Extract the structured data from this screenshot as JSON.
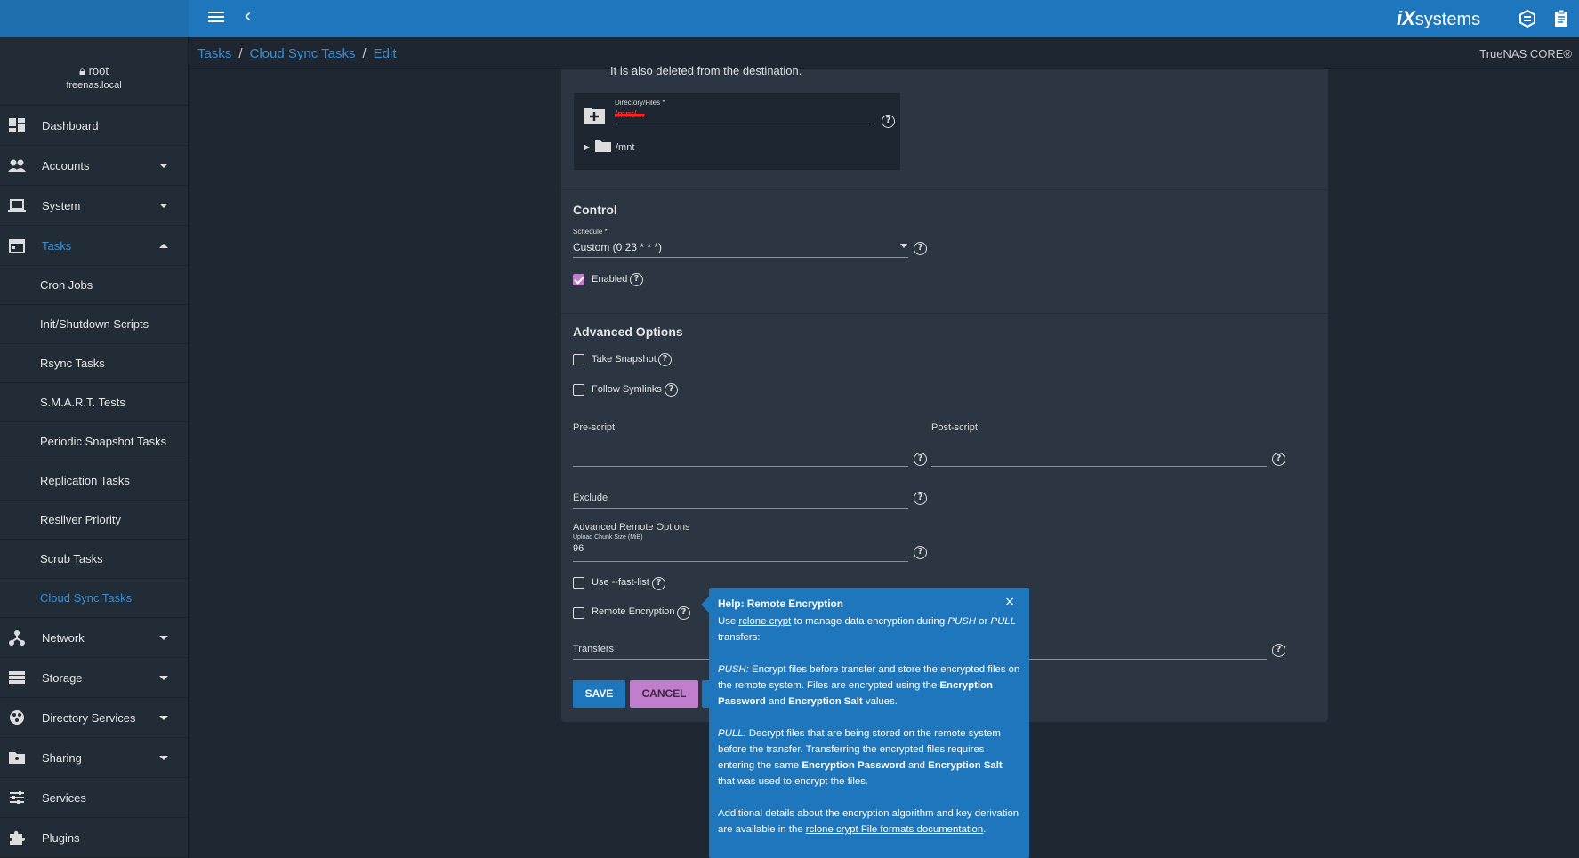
{
  "topbar": {
    "brand_ix": "iX",
    "brand_systems": "systems"
  },
  "breadcrumb": {
    "items": [
      "Tasks",
      "Cloud Sync Tasks",
      "Edit"
    ]
  },
  "product_name": "TrueNAS CORE®",
  "user": {
    "name": "root",
    "host": "freenas.local"
  },
  "sidebar": {
    "items": [
      {
        "label": "Dashboard",
        "icon": "dashboard-icon"
      },
      {
        "label": "Accounts",
        "icon": "people-icon"
      },
      {
        "label": "System",
        "icon": "laptop-icon"
      },
      {
        "label": "Tasks",
        "icon": "calendar-icon"
      },
      {
        "label": "Network",
        "icon": "network-icon"
      },
      {
        "label": "Storage",
        "icon": "storage-icon"
      },
      {
        "label": "Directory Services",
        "icon": "directory-icon"
      },
      {
        "label": "Sharing",
        "icon": "folder-share-icon"
      },
      {
        "label": "Services",
        "icon": "sliders-icon"
      },
      {
        "label": "Plugins",
        "icon": "puzzle-icon"
      }
    ],
    "task_subitems": [
      "Cron Jobs",
      "Init/Shutdown Scripts",
      "Rsync Tasks",
      "S.M.A.R.T. Tests",
      "Periodic Snapshot Tasks",
      "Replication Tasks",
      "Resilver Priority",
      "Scrub Tasks",
      "Cloud Sync Tasks"
    ]
  },
  "form": {
    "top_text_pre": "It is also ",
    "top_text_link": "deleted",
    "top_text_post": " from the destination.",
    "directory_label": "Directory/Files *",
    "directory_value": "/mnt/...",
    "tree_root": "/mnt",
    "control_title": "Control",
    "schedule_label": "Schedule *",
    "schedule_value": "Custom (0 23 * * *)",
    "enabled_label": "Enabled",
    "enabled_checked": true,
    "advanced_title": "Advanced Options",
    "take_snapshot_label": "Take Snapshot",
    "follow_symlinks_label": "Follow Symlinks",
    "prescript_label": "Pre-script",
    "postscript_label": "Post-script",
    "exclude_label": "Exclude",
    "adv_remote_label": "Advanced Remote Options",
    "chunk_label": "Upload Chunk Size (MiB)",
    "chunk_value": "96",
    "fast_list_label": "Use --fast-list",
    "remote_encryption_label": "Remote Encryption",
    "transfers_label": "Transfers",
    "save_label": "SAVE",
    "cancel_label": "CANCEL"
  },
  "help_popover": {
    "title": "Help: Remote Encryption",
    "close": "×",
    "p1_pre": "Use ",
    "p1_link": "rclone crypt",
    "p1_mid": " to manage data encryption during ",
    "p1_push": "PUSH",
    "p1_or": " or ",
    "p1_pull": "PULL",
    "p1_post": " transfers:",
    "p2_term": "PUSH:",
    "p2_a": " Encrypt files before transfer and store the encrypted files on the remote system. Files are encrypted using the ",
    "p2_b1": "Encryption Password",
    "p2_and": " and ",
    "p2_b2": "Encryption Salt",
    "p2_end": " values.",
    "p3_term": "PULL:",
    "p3_a": " Decrypt files that are being stored on the remote system before the transfer. Transferring the encrypted files requires entering the same ",
    "p3_b1": "Encryption Password",
    "p3_and": " and ",
    "p3_b2": "Encryption Salt",
    "p3_end": " that was used to encrypt the files.",
    "p4_a": "Additional details about the encryption algorithm and key derivation are available in the ",
    "p4_link": "rclone crypt File formats documentation",
    "p4_end": "."
  }
}
